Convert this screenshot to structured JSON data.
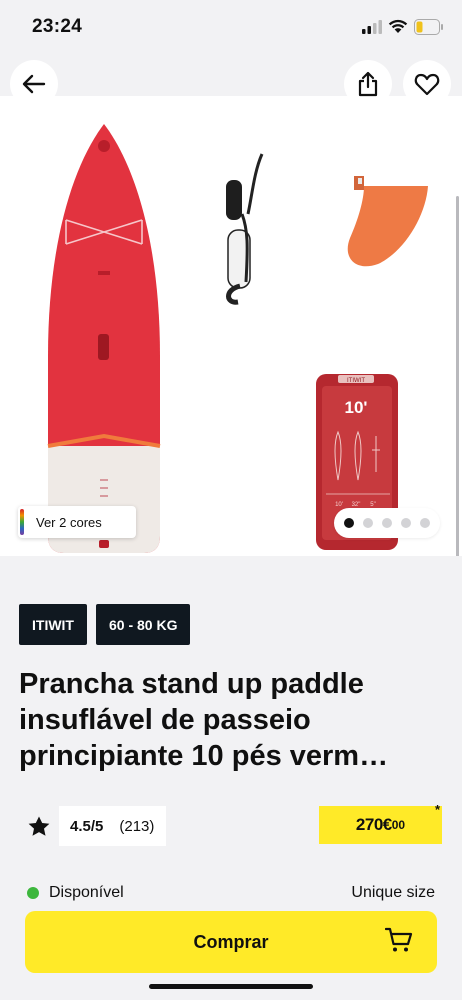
{
  "status_bar": {
    "time": "23:24"
  },
  "gallery": {
    "variant_label": "Ver 2 cores",
    "page_count": 5,
    "active_page": 1,
    "fin_color": "#ee7a45",
    "board_color": "#e2333f",
    "bag_color": "#b5282f"
  },
  "bag": {
    "brand": "ITIWIT",
    "size_label": "10'",
    "specs": [
      "10'",
      "32\"",
      "5\""
    ]
  },
  "tags": [
    "ITIWIT",
    "60 - 80 KG"
  ],
  "product": {
    "title": "Prancha stand up paddle insuflável de passeio principiante 10 pés verm…"
  },
  "rating": {
    "score": "4.5/5",
    "count": "(213)"
  },
  "price": {
    "amount": "270€",
    "cents": "00",
    "footnote_mark": "*"
  },
  "availability": {
    "status": "Disponível",
    "size": "Unique size"
  },
  "buy_button": {
    "label": "Comprar"
  },
  "icons": [
    "arrow-left-icon",
    "share-icon",
    "heart-icon",
    "star-icon",
    "cart-icon"
  ],
  "colors": {
    "accent": "#ffea28",
    "tag_bg": "#101820",
    "available": "#3db73d"
  }
}
